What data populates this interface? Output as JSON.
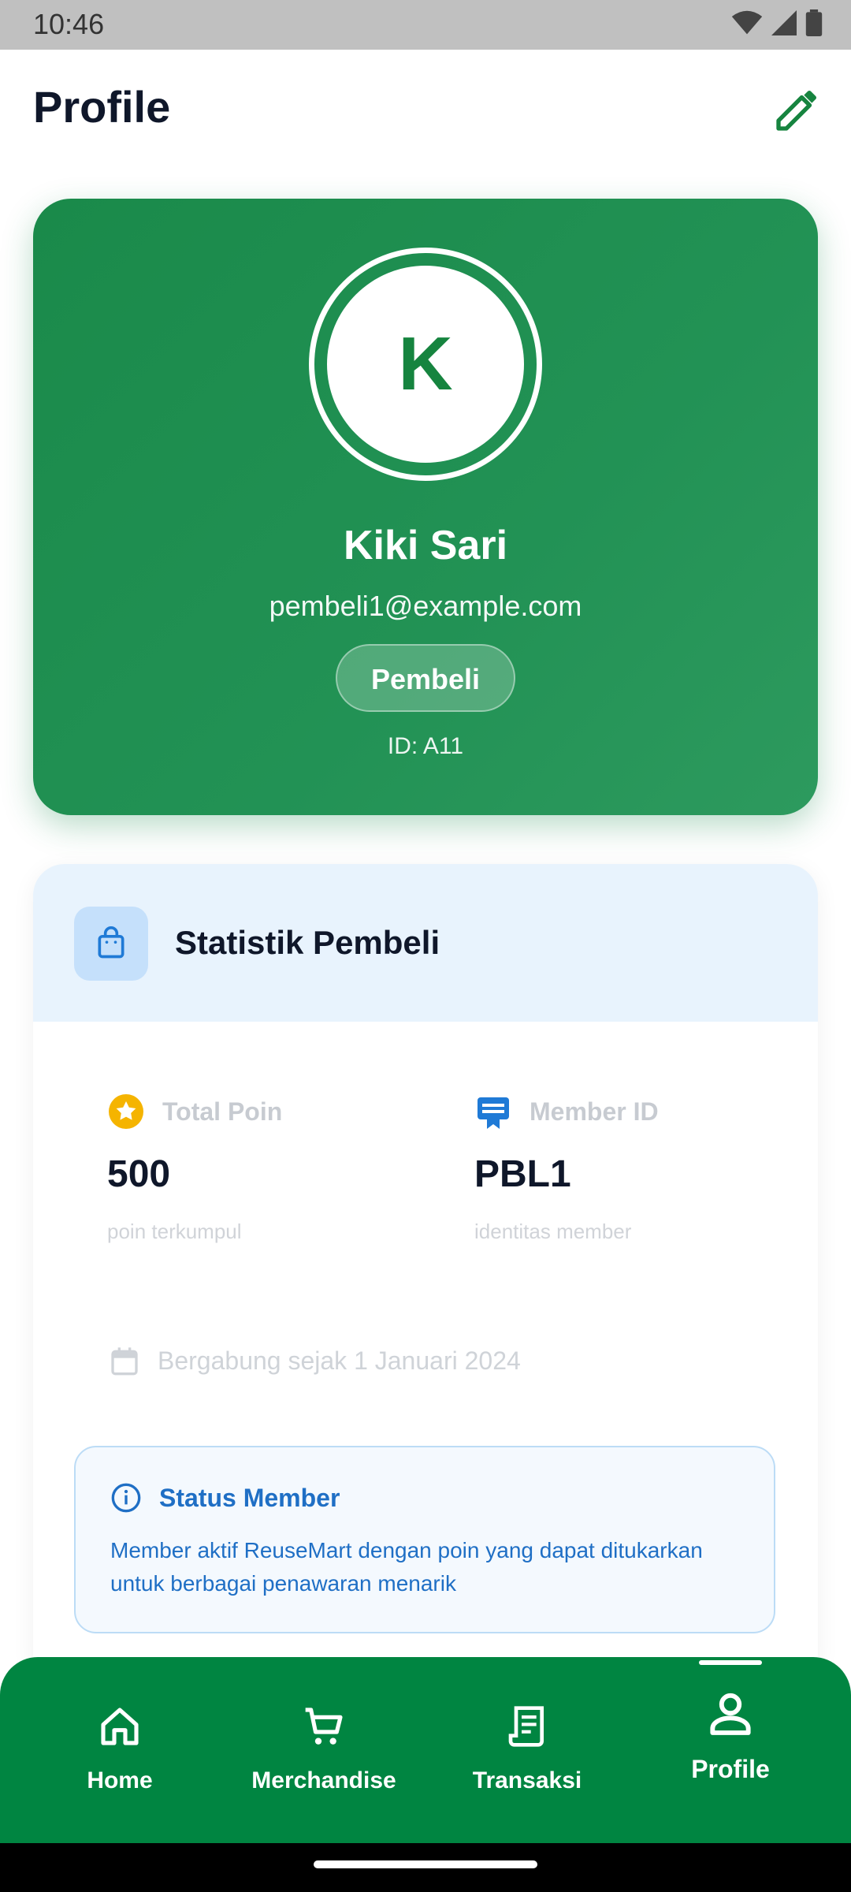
{
  "status_bar": {
    "time": "10:46"
  },
  "app_bar": {
    "title": "Profile"
  },
  "profile": {
    "initial": "K",
    "name": "Kiki Sari",
    "email": "pembeli1@example.com",
    "role": "Pembeli",
    "id_text": "ID: A11"
  },
  "stats": {
    "title": "Statistik Pembeli",
    "total_points": {
      "label": "Total Poin",
      "value": "500",
      "sub": "poin terkumpul"
    },
    "member_id": {
      "label": "Member ID",
      "value": "PBL1",
      "sub": "identitas member"
    },
    "joined": "Bergabung sejak 1 Januari 2024",
    "status": {
      "title": "Status Member",
      "description": "Member aktif ReuseMart dengan poin yang dapat ditukarkan untuk berbagai penawaran menarik"
    }
  },
  "bottom_nav": {
    "items": [
      {
        "label": "Home",
        "icon": "home-icon"
      },
      {
        "label": "Merchandise",
        "icon": "cart-icon"
      },
      {
        "label": "Transaksi",
        "icon": "receipt-icon"
      },
      {
        "label": "Profile",
        "icon": "person-icon"
      }
    ],
    "active_index": 3
  },
  "colors": {
    "brand_green": "#008541",
    "hero_green": "#1f8f50",
    "info_blue": "#1f6fc5",
    "star_yellow": "#f5b400"
  }
}
